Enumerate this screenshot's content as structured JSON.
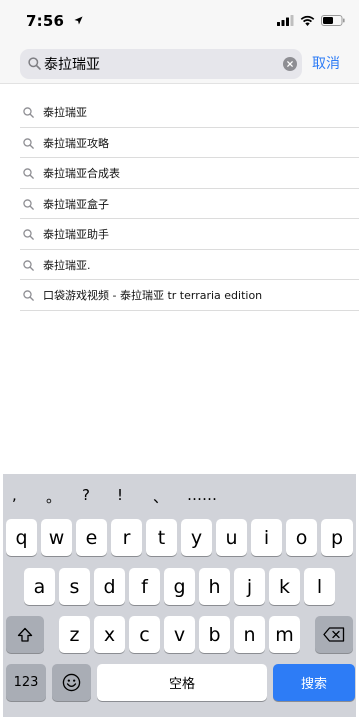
{
  "status_bar": {
    "time": "7:56"
  },
  "search": {
    "query": "泰拉瑞亚",
    "cancel_label": "取消"
  },
  "suggestions": [
    "泰拉瑞亚",
    "泰拉瑞亚攻略",
    "泰拉瑞亚合成表",
    "泰拉瑞亚盒子",
    "泰拉瑞亚助手",
    "泰拉瑞亚.",
    "口袋游戏视频 - 泰拉瑞亚 tr terraria edition"
  ],
  "keyboard": {
    "candidates": [
      ",",
      "。",
      "?",
      "!",
      "、",
      "……"
    ],
    "row1": [
      "q",
      "w",
      "e",
      "r",
      "t",
      "y",
      "u",
      "i",
      "o",
      "p"
    ],
    "row2": [
      "a",
      "s",
      "d",
      "f",
      "g",
      "h",
      "j",
      "k",
      "l"
    ],
    "row3": [
      "z",
      "x",
      "c",
      "v",
      "b",
      "n",
      "m"
    ],
    "numbers_label": "123",
    "space_label": "空格",
    "search_label": "搜索"
  },
  "colors": {
    "accent": "#2e7cf6",
    "search_key": "#2d7cf6"
  }
}
